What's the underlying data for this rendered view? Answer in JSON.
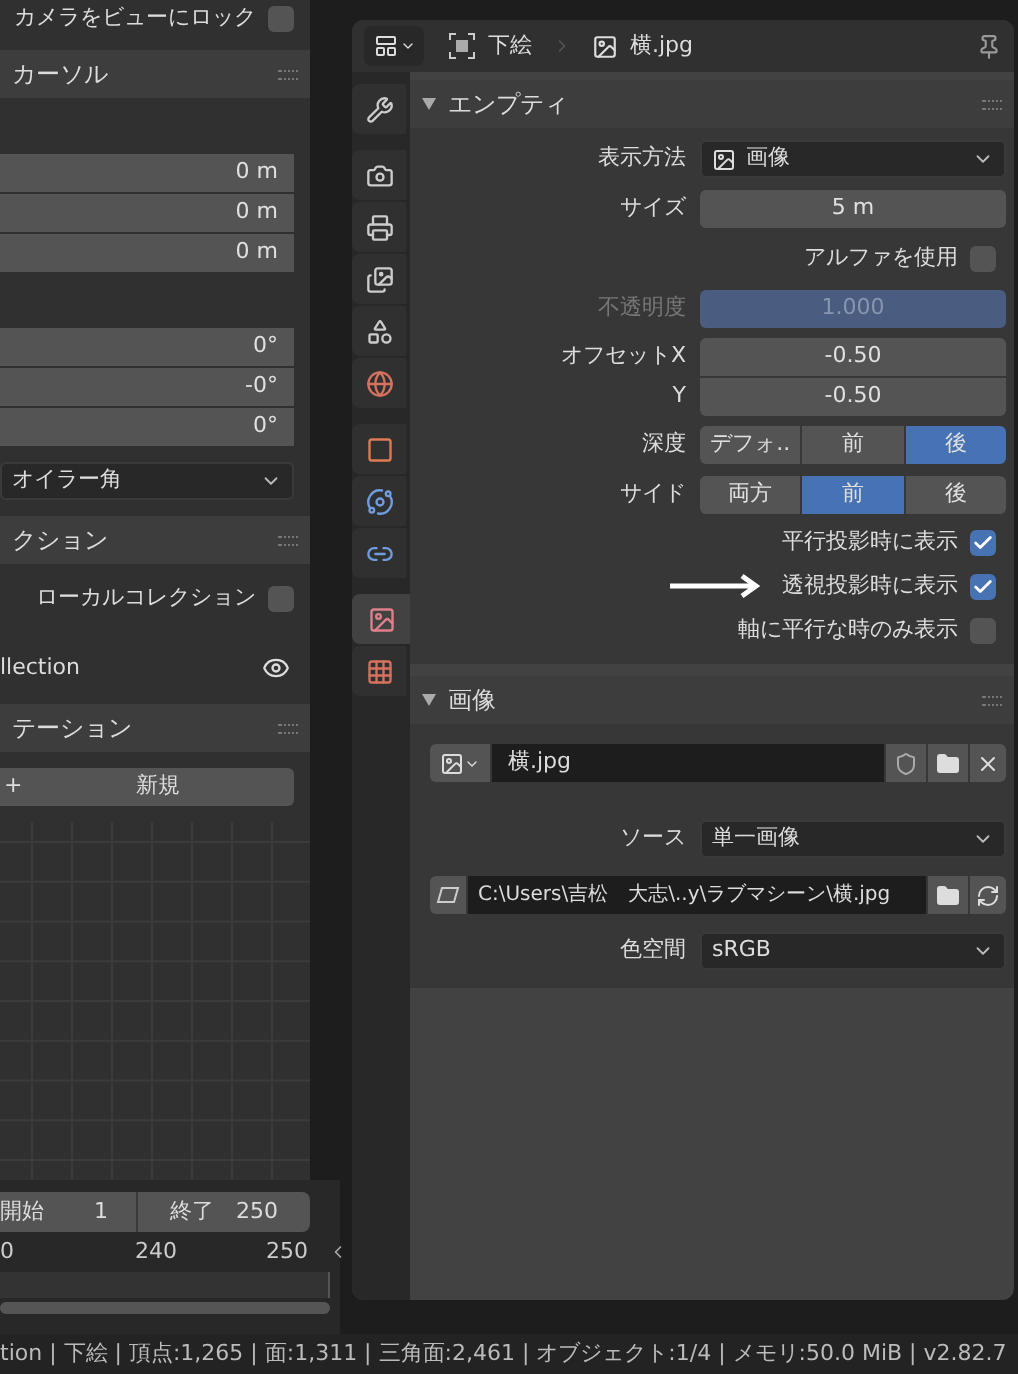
{
  "sidebar": {
    "lock_camera": {
      "label": "カメラをビューにロック",
      "checked": false
    },
    "cursor_panel": {
      "title": "カーソル",
      "location": [
        "0 m",
        "0 m",
        "0 m"
      ],
      "rotation": [
        "0°",
        "-0°",
        "0°"
      ],
      "rotation_mode": "オイラー角"
    },
    "collection_panel": {
      "title": "クション",
      "local_collection": {
        "label": "ローカルコレクション",
        "checked": false
      },
      "collection": "llection"
    },
    "annotation_panel": {
      "title": "テーション",
      "new_button": {
        "icon": "+",
        "label": "新規"
      }
    }
  },
  "timeline": {
    "start": {
      "label": "開始",
      "value": "1"
    },
    "end": {
      "label": "終了",
      "value": "250"
    },
    "ticks": [
      "0",
      "240",
      "250"
    ]
  },
  "properties": {
    "breadcrumb": [
      "下絵",
      "横.jpg"
    ],
    "tabs": [
      {
        "kind": "tool",
        "selected": false
      },
      {
        "kind": "render",
        "selected": false
      },
      {
        "kind": "output",
        "selected": false
      },
      {
        "kind": "view_layer",
        "selected": false
      },
      {
        "kind": "scene",
        "selected": false
      },
      {
        "kind": "world",
        "selected": false
      },
      {
        "kind": "object",
        "selected": false
      },
      {
        "kind": "physics",
        "selected": false
      },
      {
        "kind": "constraints",
        "selected": false
      },
      {
        "kind": "data",
        "selected": true
      },
      {
        "kind": "texture",
        "selected": false
      }
    ],
    "empty_panel": {
      "title": "エンプティ",
      "expanded": true,
      "display_as": {
        "label": "表示方法",
        "value": "画像"
      },
      "size": {
        "label": "サイズ",
        "value": "5 m"
      },
      "use_alpha": {
        "label": "アルファを使用",
        "checked": false
      },
      "opacity": {
        "label": "不透明度",
        "value": "1.000",
        "level": 1,
        "disabled": true
      },
      "offset": [
        {
          "label": "オフセットX",
          "value": "-0.50"
        },
        {
          "label": "Y",
          "value": "-0.50"
        }
      ],
      "depth": {
        "label": "深度",
        "options": [
          {
            "label": "デフォ..",
            "selected": false
          },
          {
            "label": "前",
            "selected": false
          },
          {
            "label": "後",
            "selected": true
          }
        ]
      },
      "side": {
        "label": "サイド",
        "options": [
          {
            "label": "両方",
            "selected": false
          },
          {
            "label": "前",
            "selected": true
          },
          {
            "label": "後",
            "selected": false
          }
        ]
      },
      "visibility": [
        {
          "label": "平行投影時に表示",
          "checked": true
        },
        {
          "label": "透視投影時に表示",
          "checked": true
        },
        {
          "label": "軸に平行な時のみ表示",
          "checked": false
        }
      ]
    },
    "image_panel": {
      "title": "画像",
      "expanded": true,
      "image": "横.jpg",
      "source": {
        "label": "ソース",
        "value": "単一画像"
      },
      "filepath": "C:\\Users\\吉松　大志\\..y\\ラブマシーン\\横.jpg",
      "color_space": {
        "label": "色空間",
        "value": "sRGB"
      }
    }
  },
  "status_bar": "tion | 下絵 | 頂点:1,265 | 面:1,311 | 三角面:2,461 | オブジェクト:1/4 | メモリ:50.0 MiB | v2.82.7"
}
